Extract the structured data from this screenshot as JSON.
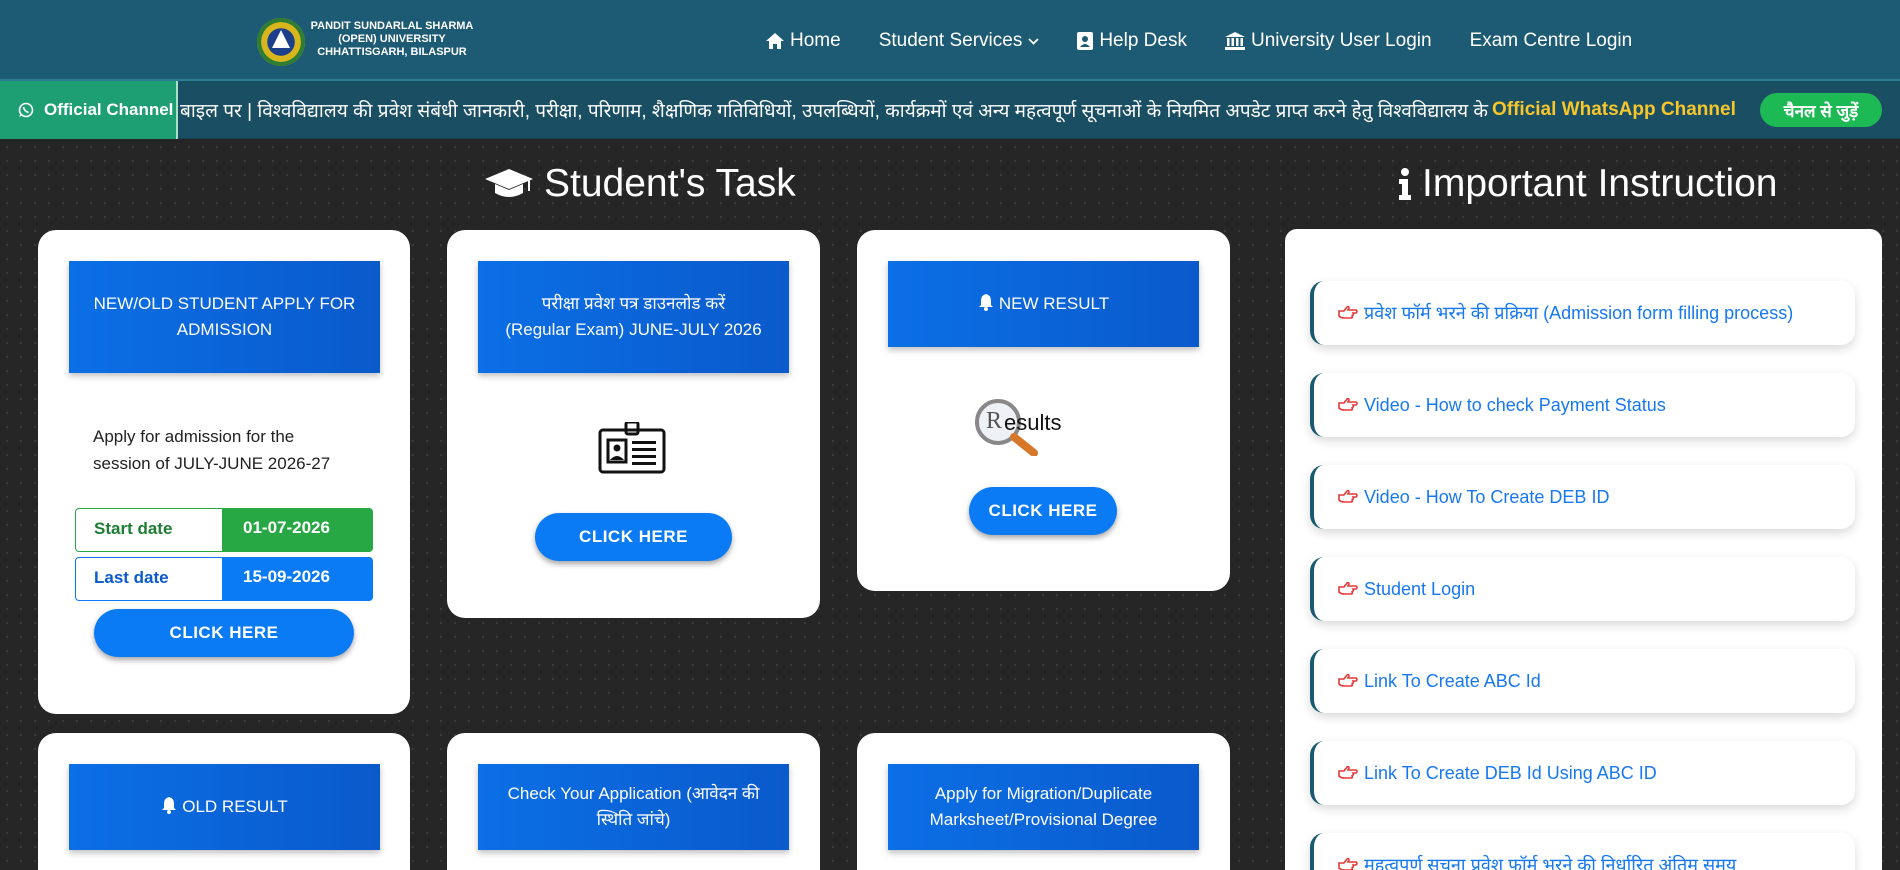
{
  "brand": {
    "line1": "PANDIT SUNDARLAL SHARMA",
    "line2": "(OPEN) UNIVERSITY",
    "line3": "CHHATTISGARH, BILASPUR"
  },
  "nav": {
    "home": "Home",
    "student_services": "Student Services",
    "help_desk": "Help Desk",
    "university_login": "University User Login",
    "exam_centre_login": "Exam Centre Login"
  },
  "ticker": {
    "channel_label": "Official Channel",
    "text": "बाइल पर  |  विश्वविद्यालय की प्रवेश संबंधी जानकारी, परीक्षा, परिणाम, शैक्षणिक गतिविधियों, उपलब्धियों, कार्यक्रमों एवं अन्य महत्वपूर्ण सूचनाओं के नियमित अपडेट प्राप्त करने हेतु विश्वविद्यालय के",
    "highlight": "Official WhatsApp Channel",
    "join_label": "चैनल से जुड़ें"
  },
  "students_task": {
    "title": "Student's Task",
    "cards": {
      "admission": {
        "head_line1": "NEW/OLD STUDENT APPLY FOR",
        "head_line2": "ADMISSION",
        "description": "Apply for admission for the session of JULY-JUNE 2026-27",
        "start_label": "Start date",
        "start_value": "01-07-2026",
        "last_label": "Last date",
        "last_value": "15-09-2026",
        "button": "CLICK HERE"
      },
      "admit_card": {
        "head_line1": "परीक्षा प्रवेश पत्र डाउनलोड करें",
        "head_line2": "(Regular Exam) JUNE-JULY 2026",
        "button": "CLICK HERE"
      },
      "new_result": {
        "head": "NEW RESULT",
        "image_text_r": "R",
        "image_text_rest": "esults",
        "button": "CLICK HERE"
      },
      "old_result": {
        "head": "OLD RESULT"
      },
      "check_application": {
        "head_line1": "Check Your Application (आवेदन की",
        "head_line2": "स्थिति जांचे)"
      },
      "migration": {
        "head_line1": "Apply for Migration/Duplicate",
        "head_line2": "Marksheet/Provisional Degree"
      }
    }
  },
  "instructions": {
    "title": "Important Instruction",
    "items": [
      "प्रवेश फॉर्म भरने की प्रक्रिया (Admission form filling process)",
      "Video - How to check Payment Status",
      "Video - How To Create DEB ID",
      "Student Login",
      "Link To Create ABC Id",
      "Link To Create DEB Id Using ABC ID",
      "महत्वपूर्ण सूचना प्रवेश फॉर्म भरने की निर्धारित अंतिम समय"
    ]
  },
  "colors": {
    "navbar": "#1d5a73",
    "ticker": "#1a4e63",
    "channel": "#1d9f73",
    "primary_blue": "#0a7bf5",
    "start_green": "#27a844",
    "highlight_yellow": "#f7c62b"
  }
}
